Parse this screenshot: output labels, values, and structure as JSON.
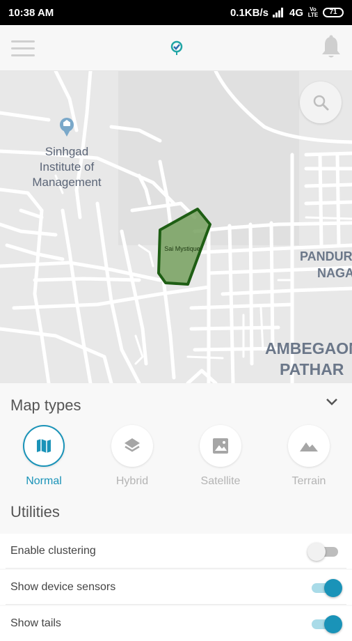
{
  "status_bar": {
    "time": "10:38 AM",
    "network_speed": "0.1KB/s",
    "network_type": "4G",
    "volte": "Vo LTE",
    "battery": "71"
  },
  "app_bar": {
    "menu_icon": "hamburger-menu-icon",
    "logo_icon": "app-logo-icon",
    "notification_icon": "bell-icon"
  },
  "map": {
    "labels": {
      "poi": "Sinhgad Institute of Management",
      "poi_line1": "Sinhgad",
      "poi_line2": "Institute of",
      "poi_line3": "Management",
      "area1_line1": "PANDUR",
      "area1_line2": "NAGA",
      "area2_line1": "AMBEGAON",
      "area2_line2": "PATHAR",
      "geofence": "Sai Mystique"
    },
    "geofence_color": "#1e5e14",
    "search_icon": "search-icon"
  },
  "map_types": {
    "title": "Map types",
    "collapse_icon": "chevron-down-icon",
    "options": [
      {
        "label": "Normal",
        "icon": "map-icon",
        "selected": true
      },
      {
        "label": "Hybrid",
        "icon": "layers-icon",
        "selected": false
      },
      {
        "label": "Satellite",
        "icon": "image-icon",
        "selected": false
      },
      {
        "label": "Terrain",
        "icon": "terrain-icon",
        "selected": false
      }
    ]
  },
  "utilities": {
    "title": "Utilities",
    "items": [
      {
        "label": "Enable clustering",
        "enabled": false
      },
      {
        "label": "Show device sensors",
        "enabled": true
      },
      {
        "label": "Show tails",
        "enabled": true
      }
    ]
  },
  "colors": {
    "accent": "#1a93b8",
    "geofence_fill": "#76a05e"
  }
}
